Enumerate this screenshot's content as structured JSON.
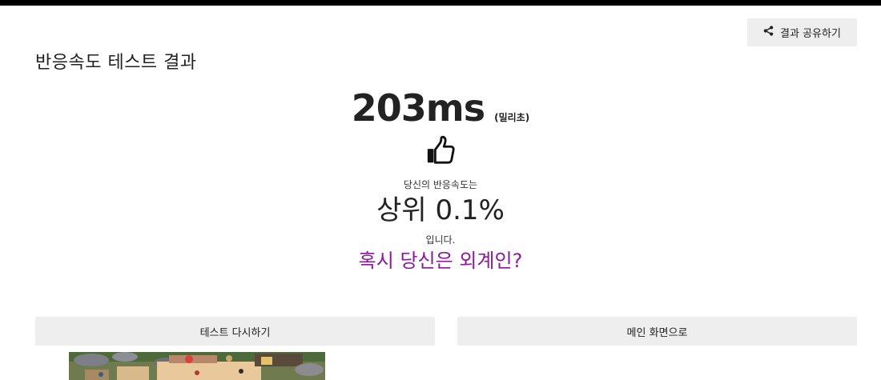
{
  "header": {
    "share_label": "결과 공유하기",
    "share_icon": "share-icon",
    "title": "반응속도 테스트 결과"
  },
  "result": {
    "time_value": "203ms",
    "time_unit": "(밀리초)",
    "result_icon": "thumbs-up-icon",
    "desc_pre": "당신의 반응속도는",
    "rank": "상위 0.1%",
    "desc_post": "입니다.",
    "comment": "혹시 당신은 외계인?"
  },
  "actions": {
    "retry_label": "테스트 다시하기",
    "main_label": "메인 화면으로"
  },
  "colors": {
    "topbar": "#000000",
    "button_bg": "#eeeeee",
    "comment": "#8a1a9a"
  }
}
